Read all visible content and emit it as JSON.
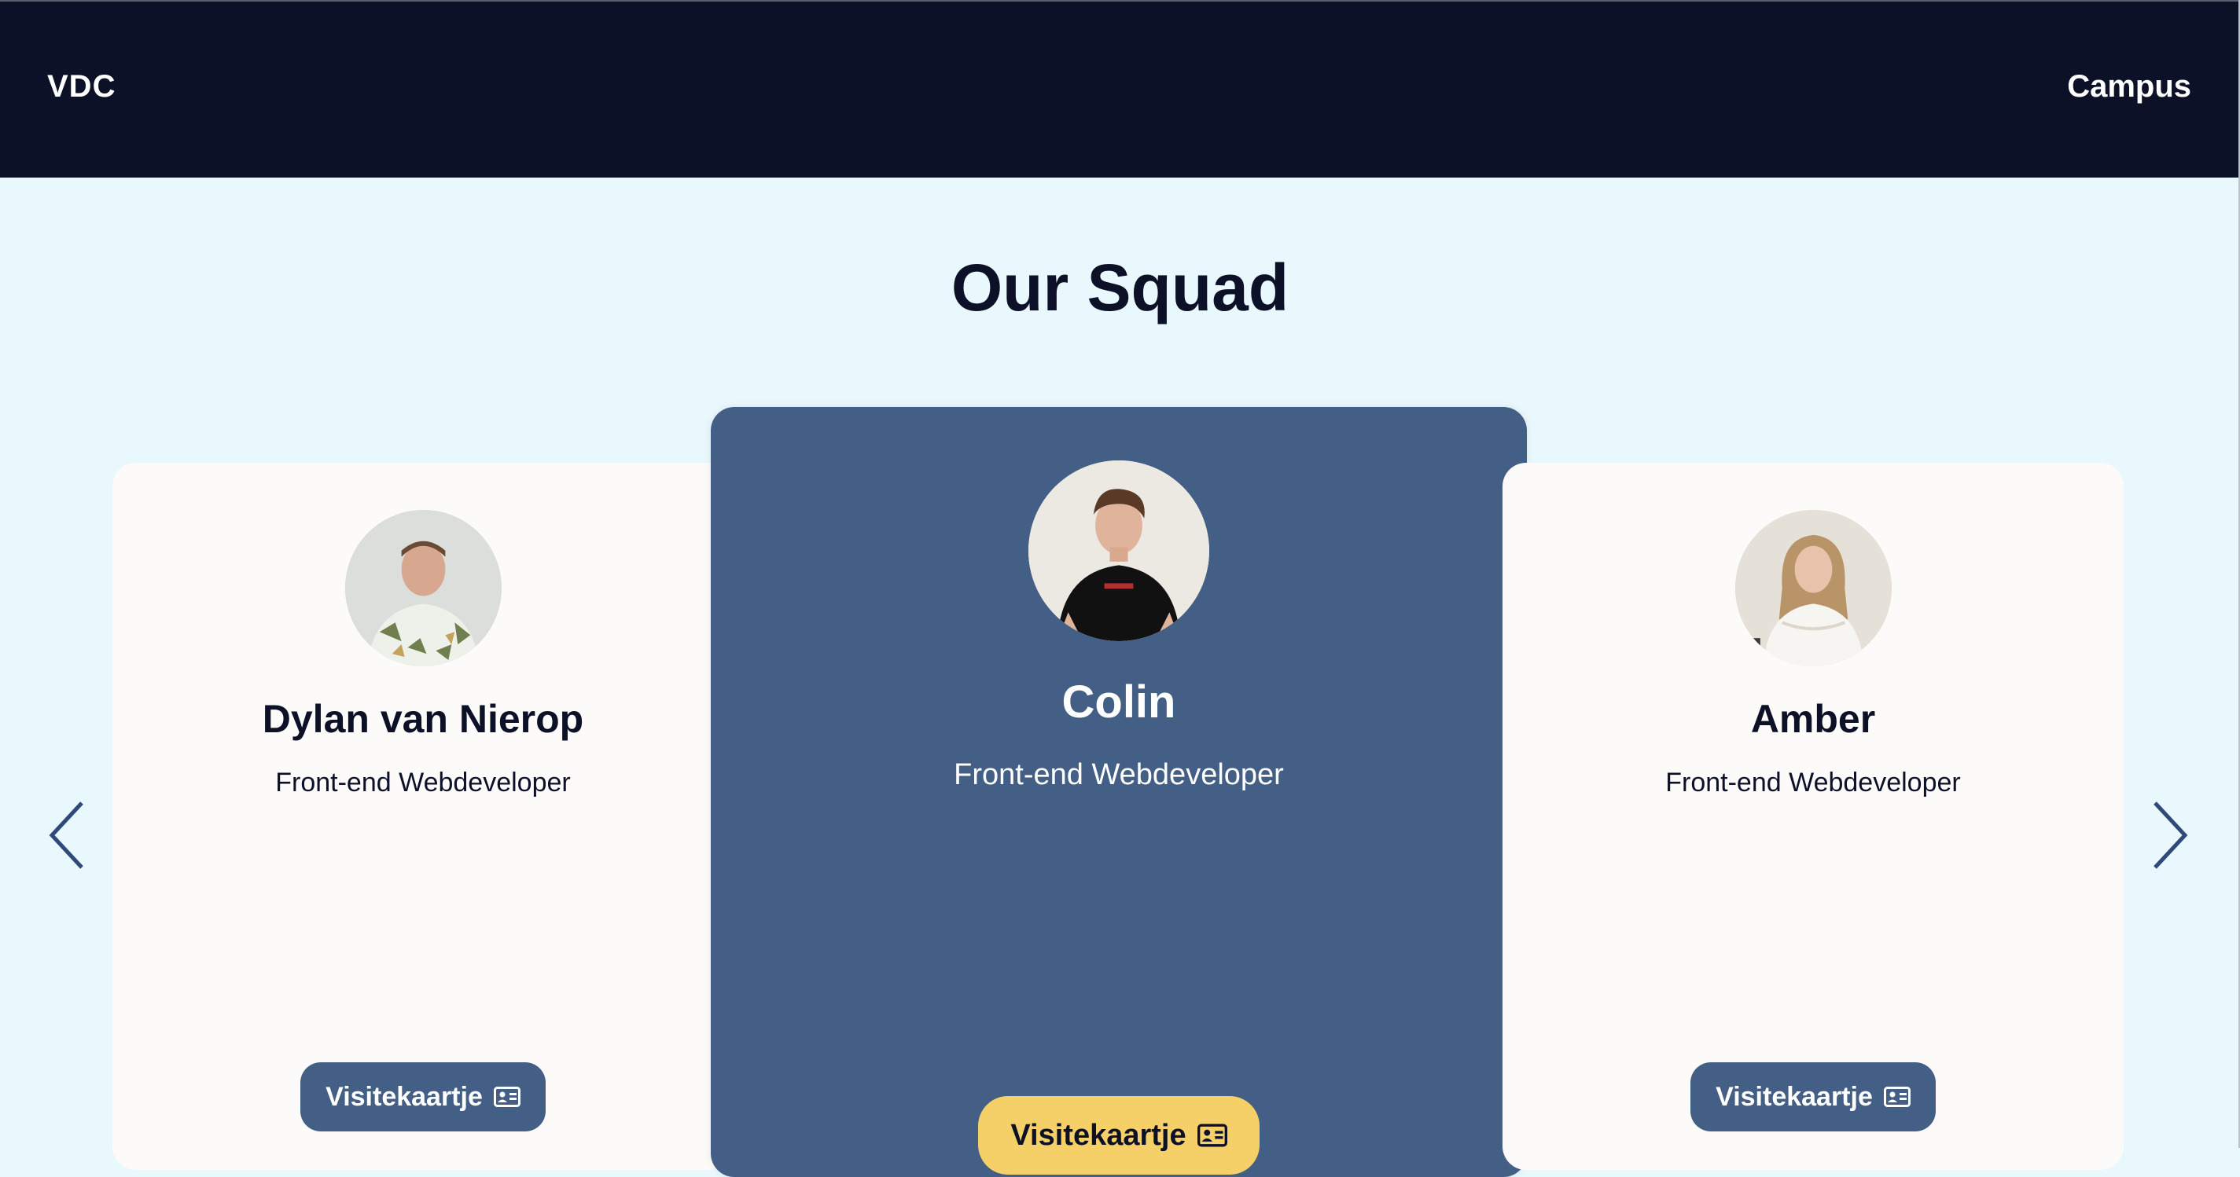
{
  "nav": {
    "brand": "VDC",
    "link": "Campus"
  },
  "page": {
    "title": "Our Squad"
  },
  "members": [
    {
      "name": "Dylan van Nierop",
      "role": "Front-end Webdeveloper",
      "button": "Visitekaartje"
    },
    {
      "name": "Colin",
      "role": "Front-end Webdeveloper",
      "button": "Visitekaartje"
    },
    {
      "name": "Amber",
      "role": "Front-end Webdeveloper",
      "button": "Visitekaartje"
    }
  ],
  "icons": {
    "prev": "chevron-left-icon",
    "next": "chevron-right-icon",
    "card": "id-card-icon"
  },
  "colors": {
    "nav_bg": "#0c1128",
    "page_bg": "#e9f8fd",
    "active_card": "#445f86",
    "card": "#fcfbf9",
    "active_button": "#f5d068"
  }
}
